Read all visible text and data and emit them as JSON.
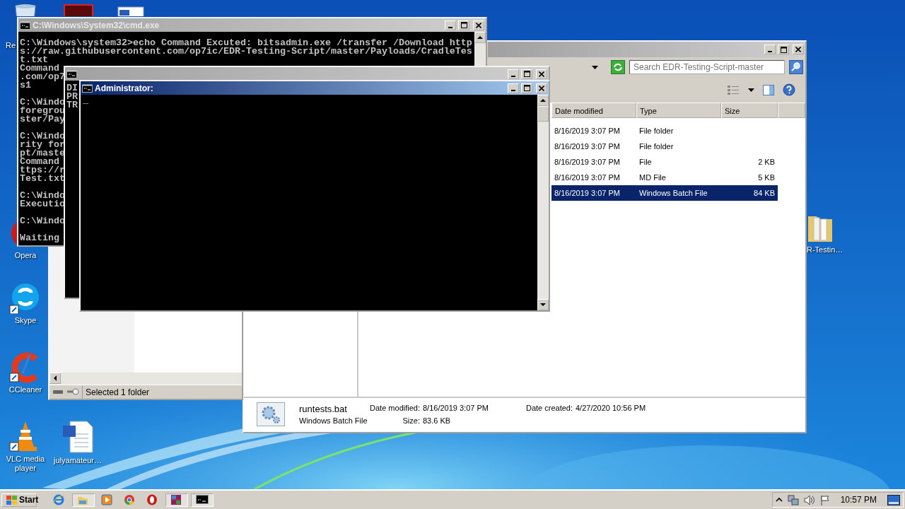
{
  "desktop_icons": [
    {
      "kind": "recycle",
      "label": "Re"
    },
    {
      "kind": "opera",
      "label": "Opera"
    },
    {
      "kind": "skype",
      "label": "Skype"
    },
    {
      "kind": "ccleaner",
      "label": "CCleaner"
    },
    {
      "kind": "vlc",
      "label": "VLC media player"
    },
    {
      "kind": "document",
      "label": "julyamateur…"
    },
    {
      "kind": "folder",
      "label": "R-Testin…"
    }
  ],
  "explorer": {
    "active": false,
    "search": {
      "placeholder": "Search EDR-Testing-Script-master"
    },
    "columns": [
      "Date modified",
      "Type",
      "Size"
    ],
    "rows": [
      {
        "date_modified": "8/16/2019 3:07 PM",
        "type": "File folder",
        "size": "",
        "selected": false
      },
      {
        "date_modified": "8/16/2019 3:07 PM",
        "type": "File folder",
        "size": "",
        "selected": false
      },
      {
        "date_modified": "8/16/2019 3:07 PM",
        "type": "File",
        "size": "2 KB",
        "selected": false
      },
      {
        "date_modified": "8/16/2019 3:07 PM",
        "type": "MD File",
        "size": "5 KB",
        "selected": false
      },
      {
        "date_modified": "8/16/2019 3:07 PM",
        "type": "Windows Batch File",
        "size": "84 KB",
        "selected": true
      }
    ],
    "details": {
      "name": "runtests.bat",
      "type": "Windows Batch File",
      "modified_label": "Date modified:",
      "modified": "8/16/2019 3:07 PM",
      "size_label": "Size:",
      "size": "83.6 KB",
      "created_label": "Date created:",
      "created": "4/27/2020 10:56 PM"
    }
  },
  "explorer_back": {
    "status": "Selected 1 folder"
  },
  "cmd_window": {
    "title": "C:\\Windows\\System32\\cmd.exe",
    "active": false,
    "blocks": [
      [
        "C:\\Windows\\system32>echo Command Excuted: bitsadmin.exe /transfer /Download http",
        "s://raw.githubusercontent.com/op7ic/EDR-Testing-Script/master/Payloads/CradleTes",
        "t.txt",
        "Command",
        ".com/op7",
        "s1"
      ],
      [
        "C:\\Windo",
        "foregrou",
        "ster/Pay"
      ],
      [
        "C:\\Windo",
        "rity for",
        "pt/maste",
        "Command",
        "ttps://r",
        "Test.txt"
      ],
      [
        "C:\\Windo",
        "Executio"
      ],
      [
        "C:\\Windo"
      ],
      [
        "Waiting"
      ]
    ]
  },
  "cmd_window_2": {
    "active": false,
    "lines": [
      "DI",
      "PR",
      "TR"
    ]
  },
  "admin_window": {
    "title": "Administrator:",
    "active": true,
    "cursor": "_"
  },
  "taskbar": {
    "start": "Start",
    "apps": [
      {
        "kind": "ie",
        "open": false
      },
      {
        "kind": "explorer",
        "open": true
      },
      {
        "kind": "media",
        "open": false
      },
      {
        "kind": "chrome",
        "open": false
      },
      {
        "kind": "opera",
        "open": false
      },
      {
        "kind": "winrar",
        "open": true
      },
      {
        "kind": "cmd",
        "open": true
      }
    ],
    "clock": "10:57 PM"
  }
}
